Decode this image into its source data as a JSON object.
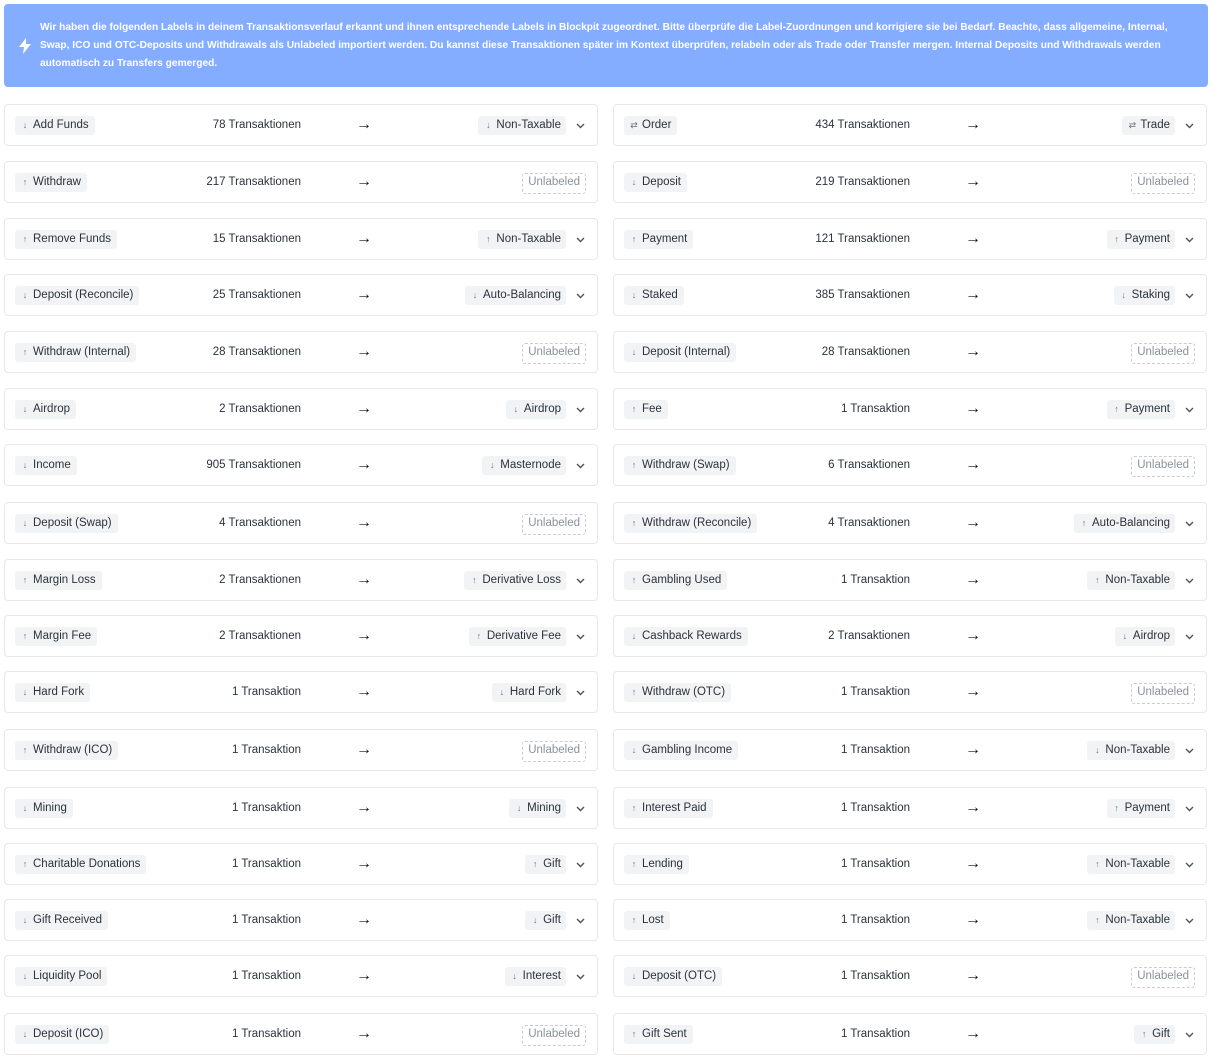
{
  "banner": {
    "text": "Wir haben die folgenden Labels in deinem Transaktionsverlauf erkannt und ihnen entsprechende Labels in Blockpit zugeordnet. Bitte überprüfe die Label-Zuordnungen und korrigiere sie bei Bedarf. Beachte, dass allgemeine, Internal, Swap, ICO und OTC-Deposits und Withdrawals als Unlabeled importiert werden. Du kannst diese Transaktionen später im Kontext überprüfen, relabeln oder als Trade oder Transfer mergen. Internal Deposits und Withdrawals werden automatisch zu Transfers gemerged.",
    "icon": "lightning-icon"
  },
  "arrow_glyph": "→",
  "left": [
    {
      "label": "Add Funds",
      "dir": "in",
      "count": "78 Transaktionen",
      "target": "Non-Taxable",
      "tdir": "in"
    },
    {
      "label": "Withdraw",
      "dir": "out",
      "count": "217 Transaktionen",
      "target": "Unlabeled",
      "tdir": ""
    },
    {
      "label": "Remove Funds",
      "dir": "out",
      "count": "15 Transaktionen",
      "target": "Non-Taxable",
      "tdir": "out"
    },
    {
      "label": "Deposit (Reconcile)",
      "dir": "in",
      "count": "25 Transaktionen",
      "target": "Auto-Balancing",
      "tdir": "in"
    },
    {
      "label": "Withdraw (Internal)",
      "dir": "out",
      "count": "28 Transaktionen",
      "target": "Unlabeled",
      "tdir": ""
    },
    {
      "label": "Airdrop",
      "dir": "in",
      "count": "2 Transaktionen",
      "target": "Airdrop",
      "tdir": "in"
    },
    {
      "label": "Income",
      "dir": "in",
      "count": "905 Transaktionen",
      "target": "Masternode",
      "tdir": "in"
    },
    {
      "label": "Deposit (Swap)",
      "dir": "in",
      "count": "4 Transaktionen",
      "target": "Unlabeled",
      "tdir": ""
    },
    {
      "label": "Margin Loss",
      "dir": "out",
      "count": "2 Transaktionen",
      "target": "Derivative Loss",
      "tdir": "out"
    },
    {
      "label": "Margin Fee",
      "dir": "out",
      "count": "2 Transaktionen",
      "target": "Derivative Fee",
      "tdir": "out"
    },
    {
      "label": "Hard Fork",
      "dir": "in",
      "count": "1 Transaktion",
      "target": "Hard Fork",
      "tdir": "in"
    },
    {
      "label": "Withdraw (ICO)",
      "dir": "out",
      "count": "1 Transaktion",
      "target": "Unlabeled",
      "tdir": ""
    },
    {
      "label": "Mining",
      "dir": "in",
      "count": "1 Transaktion",
      "target": "Mining",
      "tdir": "in"
    },
    {
      "label": "Charitable Donations",
      "dir": "out",
      "count": "1 Transaktion",
      "target": "Gift",
      "tdir": "out"
    },
    {
      "label": "Gift Received",
      "dir": "in",
      "count": "1 Transaktion",
      "target": "Gift",
      "tdir": "in"
    },
    {
      "label": "Liquidity Pool",
      "dir": "in",
      "count": "1 Transaktion",
      "target": "Interest",
      "tdir": "in"
    },
    {
      "label": "Deposit (ICO)",
      "dir": "in",
      "count": "1 Transaktion",
      "target": "Unlabeled",
      "tdir": ""
    }
  ],
  "right": [
    {
      "label": "Order",
      "dir": "swap",
      "count": "434 Transaktionen",
      "target": "Trade",
      "tdir": "swap"
    },
    {
      "label": "Deposit",
      "dir": "in",
      "count": "219 Transaktionen",
      "target": "Unlabeled",
      "tdir": ""
    },
    {
      "label": "Payment",
      "dir": "out",
      "count": "121 Transaktionen",
      "target": "Payment",
      "tdir": "out"
    },
    {
      "label": "Staked",
      "dir": "in",
      "count": "385 Transaktionen",
      "target": "Staking",
      "tdir": "in"
    },
    {
      "label": "Deposit (Internal)",
      "dir": "in",
      "count": "28 Transaktionen",
      "target": "Unlabeled",
      "tdir": ""
    },
    {
      "label": "Fee",
      "dir": "out",
      "count": "1 Transaktion",
      "target": "Payment",
      "tdir": "out"
    },
    {
      "label": "Withdraw (Swap)",
      "dir": "out",
      "count": "6 Transaktionen",
      "target": "Unlabeled",
      "tdir": ""
    },
    {
      "label": "Withdraw (Reconcile)",
      "dir": "out",
      "count": "4 Transaktionen",
      "target": "Auto-Balancing",
      "tdir": "out"
    },
    {
      "label": "Gambling Used",
      "dir": "out",
      "count": "1 Transaktion",
      "target": "Non-Taxable",
      "tdir": "out"
    },
    {
      "label": "Cashback Rewards",
      "dir": "in",
      "count": "2 Transaktionen",
      "target": "Airdrop",
      "tdir": "in"
    },
    {
      "label": "Withdraw (OTC)",
      "dir": "out",
      "count": "1 Transaktion",
      "target": "Unlabeled",
      "tdir": ""
    },
    {
      "label": "Gambling Income",
      "dir": "in",
      "count": "1 Transaktion",
      "target": "Non-Taxable",
      "tdir": "in"
    },
    {
      "label": "Interest Paid",
      "dir": "out",
      "count": "1 Transaktion",
      "target": "Payment",
      "tdir": "out"
    },
    {
      "label": "Lending",
      "dir": "out",
      "count": "1 Transaktion",
      "target": "Non-Taxable",
      "tdir": "out"
    },
    {
      "label": "Lost",
      "dir": "out",
      "count": "1 Transaktion",
      "target": "Non-Taxable",
      "tdir": "out"
    },
    {
      "label": "Deposit (OTC)",
      "dir": "in",
      "count": "1 Transaktion",
      "target": "Unlabeled",
      "tdir": ""
    },
    {
      "label": "Gift Sent",
      "dir": "out",
      "count": "1 Transaktion",
      "target": "Gift",
      "tdir": "out"
    }
  ]
}
